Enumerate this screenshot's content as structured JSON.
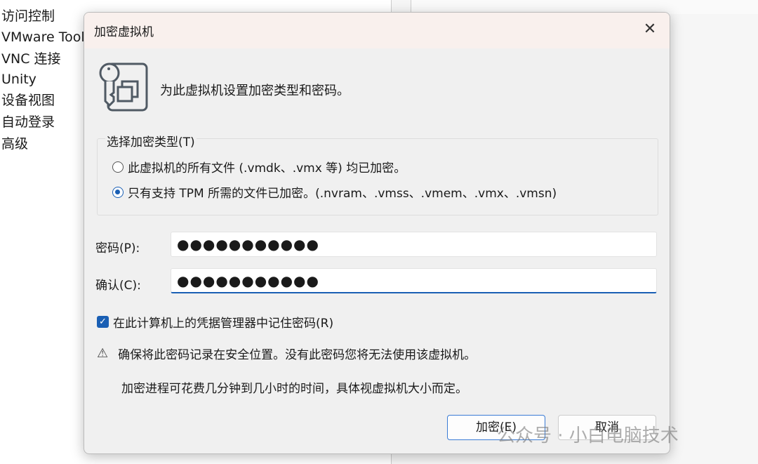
{
  "sidebar": {
    "items": [
      "访问控制",
      "VMware Tools",
      "VNC 连接",
      "Unity",
      "设备视图",
      "自动登录",
      "高级"
    ]
  },
  "dialog": {
    "title": "加密虚拟机",
    "description": "为此虚拟机设置加密类型和密码。",
    "encryption_group": {
      "label": "选择加密类型(T)",
      "options": [
        {
          "label": "此虚拟机的所有文件 (.vmdk、.vmx 等) 均已加密。",
          "selected": false
        },
        {
          "label": "只有支持 TPM 所需的文件已加密。(.nvram、.vmss、.vmem、.vmx、.vmsn)",
          "selected": true
        }
      ]
    },
    "password": {
      "label": "密码(P):",
      "value": "●●●●●●●●●●●"
    },
    "confirm": {
      "label": "确认(C):",
      "value": "●●●●●●●●●●●"
    },
    "remember": {
      "label": "在此计算机上的凭据管理器中记住密码(R)",
      "checked": true
    },
    "warning": "确保将此密码记录在安全位置。没有此密码您将无法使用该虚拟机。",
    "note": "加密进程可花费几分钟到几小时的时间，具体视虚拟机大小而定。",
    "encrypt_button": "加密(E)",
    "cancel_button": "取消"
  },
  "watermark": "公众号 · 小白电脑技术",
  "colors": {
    "accent": "#1a5fb4",
    "titlebar": "#f9f0ed"
  }
}
